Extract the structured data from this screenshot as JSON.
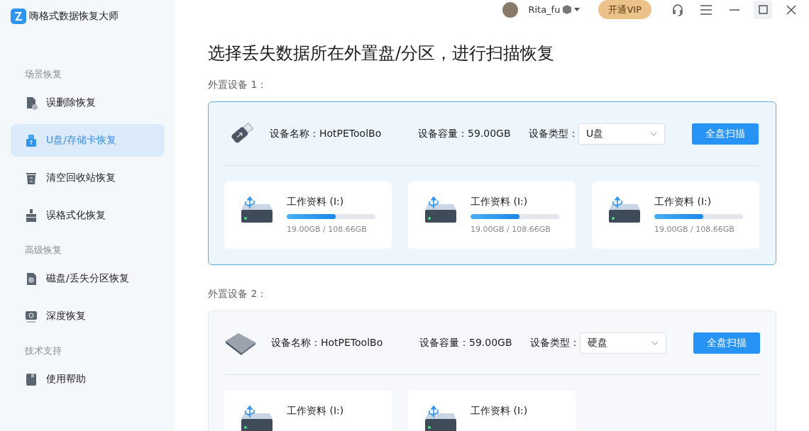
{
  "app": {
    "title": "嗨格式数据恢复大师"
  },
  "sidebar": {
    "groups": [
      {
        "heading": "场景恢复",
        "items": [
          {
            "label": "误删除恢复",
            "kind": "deleted",
            "selected": false
          },
          {
            "label": "U盘/存储卡恢复",
            "kind": "usb",
            "selected": true
          },
          {
            "label": "清空回收站恢复",
            "kind": "bin",
            "selected": false
          },
          {
            "label": "误格式化恢复",
            "kind": "format",
            "selected": false
          }
        ]
      },
      {
        "heading": "高级恢复",
        "items": [
          {
            "label": "磁盘/丢失分区恢复",
            "kind": "partition",
            "selected": false
          },
          {
            "label": "深度恢复",
            "kind": "deep",
            "selected": false
          }
        ]
      },
      {
        "heading": "技术支持",
        "items": [
          {
            "label": "使用帮助",
            "kind": "help",
            "selected": false
          }
        ]
      }
    ]
  },
  "header": {
    "username": "Rita_fu",
    "vip_button": "开通VIP"
  },
  "main": {
    "title": "选择丢失数据所在外置盘/分区，进行扫描恢复",
    "devices": [
      {
        "heading": "外置设备 1：",
        "kind": "usb",
        "selected": true,
        "name": "设备名称：HotPEToolBo",
        "capacity": "设备容量：59.00GB",
        "type_label": "设备类型：",
        "type_value": "U盘",
        "scan_button": "全盘扫描",
        "partitions": [
          {
            "label": "工作资料 (I:)",
            "level": 0.55,
            "usage": "19.00GB / 108.66GB"
          },
          {
            "label": "工作资料 (I:)",
            "level": 0.55,
            "usage": "19.00GB / 108.66GB"
          },
          {
            "label": "工作资料 (I:)",
            "level": 0.55,
            "usage": "19.00GB / 108.66GB"
          }
        ]
      },
      {
        "heading": "外置设备 2：",
        "kind": "disk",
        "selected": false,
        "name": "设备名称：HotPEToolBo",
        "capacity": "设备容量：59.00GB",
        "type_label": "设备类型：",
        "type_value": "硬盘",
        "scan_button": "全盘扫描",
        "partitions": [
          {
            "label": "工作资料 (I:)"
          },
          {
            "label": "工作资料 (I:)"
          }
        ]
      }
    ]
  }
}
